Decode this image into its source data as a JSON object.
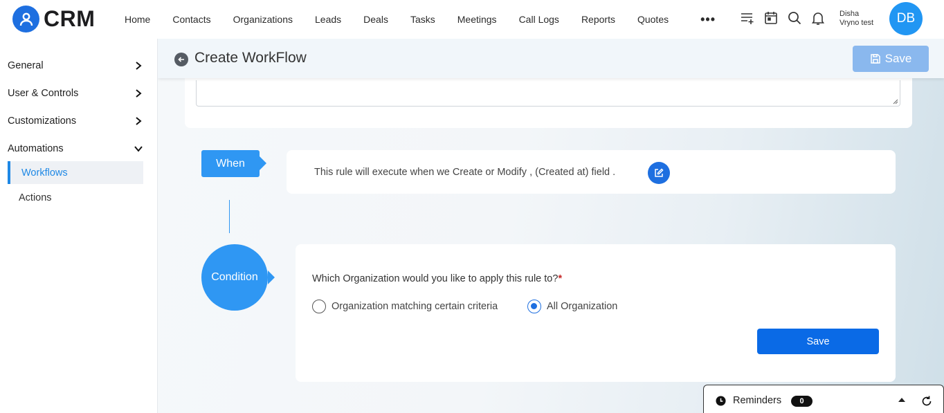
{
  "app": {
    "name": "CRM"
  },
  "nav": {
    "items": [
      "Home",
      "Contacts",
      "Organizations",
      "Leads",
      "Deals",
      "Tasks",
      "Meetings",
      "Call Logs",
      "Reports",
      "Quotes"
    ],
    "more": "•••"
  },
  "user": {
    "first_name": "Disha",
    "org": "Vryno test",
    "initials": "DB"
  },
  "sidebar": {
    "sections": [
      {
        "label": "General",
        "state": "collapsed"
      },
      {
        "label": "User & Controls",
        "state": "collapsed"
      },
      {
        "label": "Customizations",
        "state": "collapsed"
      },
      {
        "label": "Automations",
        "state": "expanded"
      }
    ],
    "sub_items": [
      {
        "label": "Workflows",
        "active": true
      },
      {
        "label": "Actions",
        "active": false
      }
    ]
  },
  "header": {
    "title": "Create WorkFlow",
    "save_label": "Save"
  },
  "when": {
    "tag": "When",
    "text": "This rule will execute when we Create or Modify , (Created at) field ."
  },
  "condition": {
    "tag": "Condition",
    "question": "Which Organization would you like to apply this rule to?",
    "required_mark": "*",
    "options": [
      {
        "label": "Organization matching certain criteria",
        "selected": false
      },
      {
        "label": "All Organization",
        "selected": true
      }
    ],
    "save_label": "Save"
  },
  "reminders": {
    "label": "Reminders",
    "count": "0"
  },
  "colors": {
    "primary": "#1e6fe0",
    "accent": "#2f97f3",
    "save_disabled": "#8ab8ee"
  }
}
